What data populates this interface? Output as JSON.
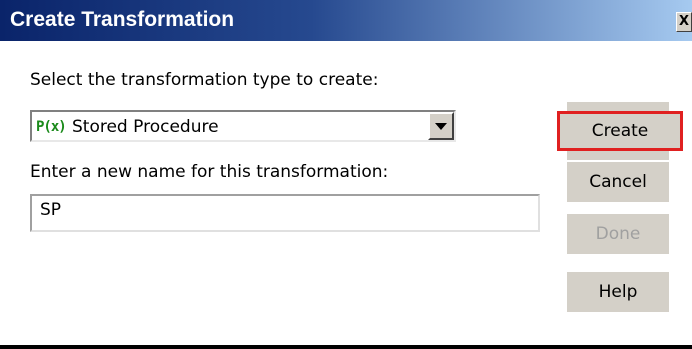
{
  "window": {
    "title": "Create Transformation",
    "close_label": "X"
  },
  "form": {
    "type_label": "Select the transformation type to create:",
    "type_select": {
      "icon": "P(x)",
      "icon_name": "stored-procedure-icon",
      "value": "Stored Procedure"
    },
    "name_label": "Enter a new name for this transformation:",
    "name_value": "SP"
  },
  "buttons": {
    "create": "Create",
    "cancel": "Cancel",
    "done": "Done",
    "help": "Help"
  },
  "colors": {
    "titlebar_start": "#0a246a",
    "titlebar_end": "#a6caf0",
    "highlight": "#e02020",
    "button_face": "#d4d0c8",
    "icon_green": "#1a8a1a",
    "disabled_text": "#a0a0a0"
  }
}
